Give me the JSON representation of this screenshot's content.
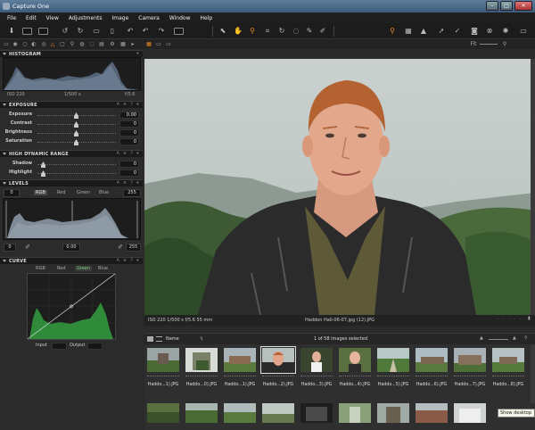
{
  "window": {
    "title": "Capture One"
  },
  "menu": [
    "File",
    "Edit",
    "View",
    "Adjustments",
    "Image",
    "Camera",
    "Window",
    "Help"
  ],
  "histogram": {
    "label": "HISTOGRAM",
    "iso": "ISO 220",
    "shutter": "1/500 s",
    "aperture": "f/5.6"
  },
  "exposure": {
    "label": "EXPOSURE",
    "rows": [
      {
        "name": "Exposure",
        "value": "0.00"
      },
      {
        "name": "Contrast",
        "value": "0"
      },
      {
        "name": "Brightness",
        "value": "0"
      },
      {
        "name": "Saturation",
        "value": "0"
      }
    ]
  },
  "hdr": {
    "label": "HIGH DYNAMIC RANGE",
    "rows": [
      {
        "name": "Shadow",
        "value": "0"
      },
      {
        "name": "Highlight",
        "value": "0"
      }
    ]
  },
  "levels": {
    "label": "LEVELS",
    "in_black": "0",
    "in_white": "255",
    "channels": [
      "RGB",
      "Red",
      "Green",
      "Blue"
    ],
    "out_black": "0",
    "mid": "0.00",
    "out_white": "255"
  },
  "curve": {
    "label": "CURVE",
    "channels": [
      "RGB",
      "Red",
      "Green",
      "Blue"
    ],
    "input_label": "Input",
    "output_label": "Output"
  },
  "viewer": {
    "status_left": "ISO 220  1/500 s  f/5.6  55 mm",
    "status_center": "Haddon Hall-06-07.jpg (12).JPG"
  },
  "browser": {
    "sort_label": "Name",
    "selection": "1 of 58 images selected",
    "thumbs": [
      "Haddo...1).JPG",
      "Haddo...0).JPG",
      "Haddo...1).JPG",
      "Haddo...2).JPG",
      "Haddo...3).JPG",
      "Haddo...4).JPG",
      "Haddo...5).JPG",
      "Haddo...6).JPG",
      "Haddo...7).JPG",
      "Haddo...8).JPG"
    ],
    "tooltip": "Show desktop"
  },
  "colors": {
    "accent": "#f08a1c",
    "panel_bg": "#2b2b2b",
    "header_bg": "#1a1a1a"
  }
}
